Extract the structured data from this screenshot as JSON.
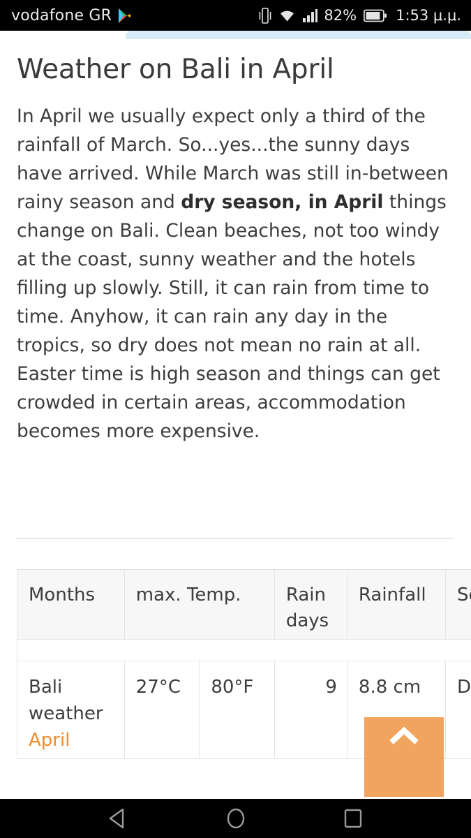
{
  "status_bar": {
    "carrier": "vodafone GR",
    "battery_percent": "82%",
    "clock": "1:53 μ.μ.",
    "icons": [
      "play-store-icon",
      "vibrate-icon",
      "wifi-icon",
      "signal-icon",
      "battery-icon"
    ]
  },
  "page": {
    "title": "Weather on Bali in April",
    "paragraph_part1": "In April we usually expect only a third of the rainfall of March. So...yes...the sunny days have arrived. While March was still in-between rainy season and ",
    "paragraph_bold": "dry season, in April",
    "paragraph_part2": " things change on Bali. Clean beaches, not too windy at the coast, sunny weather and the hotels filling up slowly. Still, it can rain from time to time. Anyhow, it can rain any day in the tropics, so dry does not mean no rain at all. Easter time is high season and things can get crowded in certain areas, accommodation becomes more expensive."
  },
  "table": {
    "caption": "",
    "headers": [
      "Months",
      "max. Temp.",
      "Rain days",
      "Rainfall",
      "Season"
    ],
    "rows": [
      {
        "months_line1": "Bali",
        "months_line2": "weather",
        "month_highlight": "April",
        "temp_c": "27°C",
        "temp_f": "80°F",
        "rain_days": "9",
        "rainfall": "8.8 cm",
        "season": "Dry season"
      }
    ]
  },
  "fab": {
    "label": "scroll-to-top",
    "color": "#ed8a30"
  },
  "nav_bar": {
    "back_label": "Back",
    "home_label": "Home",
    "recents_label": "Recents"
  },
  "colors": {
    "accent_orange": "#ee8c2d",
    "banner_blue": "#d6edf7",
    "text": "#3d3d3d",
    "header_bg": "#f7f7f7"
  }
}
